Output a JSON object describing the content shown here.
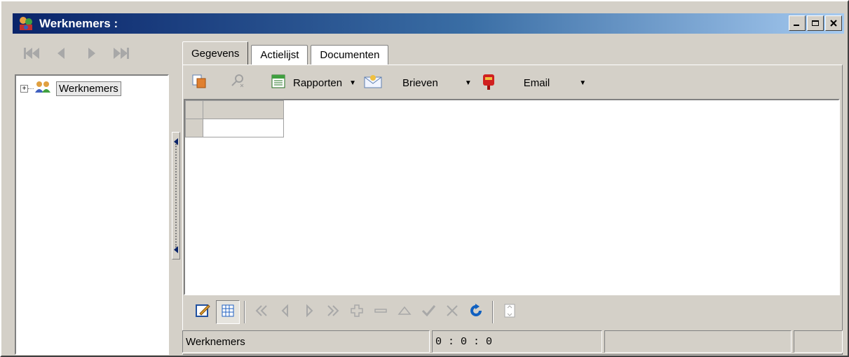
{
  "window": {
    "title": "Werknemers :",
    "buttons": {
      "minimize": "_",
      "maximize": "□",
      "close": "×"
    }
  },
  "left_nav": {
    "icons": [
      "first-record-icon",
      "prev-record-icon",
      "next-record-icon",
      "last-record-icon"
    ]
  },
  "tree": {
    "root": {
      "label": "Werknemers",
      "expander": "+",
      "icon": "people-icon"
    }
  },
  "tabs": [
    {
      "label": "Gegevens",
      "active": true
    },
    {
      "label": "Actielijst",
      "active": false
    },
    {
      "label": "Documenten",
      "active": false
    }
  ],
  "toolbar": {
    "rapporten_label": "Rapporten",
    "brieven_label": "Brieven",
    "email_label": "Email",
    "dropdown_glyph": "▼"
  },
  "bottom_toolbar": {
    "icons": [
      "edit-icon",
      "grid-view-icon",
      "first-icon",
      "prior-icon",
      "next-icon",
      "last-icon",
      "insert-icon",
      "delete-icon",
      "edit-up-icon",
      "post-icon",
      "cancel-icon",
      "refresh-icon",
      "filter-icon"
    ]
  },
  "statusbar": {
    "section": "Werknemers",
    "position": "0 : 0 : 0",
    "panel3": "",
    "panel4": ""
  },
  "colors": {
    "titlebar_start": "#0a246a",
    "titlebar_end": "#a6caf0",
    "face": "#d4d0c8"
  }
}
